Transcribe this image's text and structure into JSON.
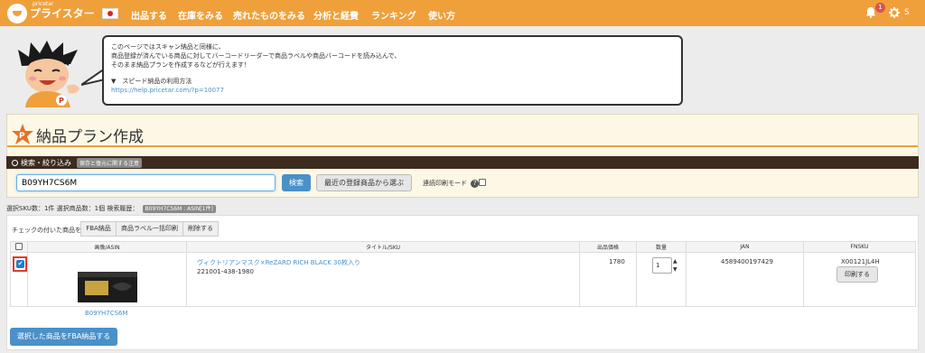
{
  "nav": {
    "logo_small": "pricetar",
    "logo_text": "プライスター",
    "items": [
      "出品する",
      "在庫をみる",
      "売れたものをみる",
      "分析と経費",
      "ランキング",
      "使い方"
    ],
    "notification_count": "1",
    "user_initial": "S"
  },
  "bubble": {
    "line1": "このページではスキャン納品と同様に、",
    "line2": "商品登録が済んでいる商品に対してバーコードリーダーで商品ラベルや商品バーコードを読み込んで、",
    "line3": "そのまま納品プランを作成するなどが行えます！",
    "speed_label": "▼　スピード納品の利用方法",
    "speed_url": "https://help.pricetar.com/?p=10077"
  },
  "page_title": "納品プラン作成",
  "search": {
    "header_label": "検索・絞り込み",
    "note_badge": "保存と復元に関する注意",
    "input_value": "B09YH7CS6M",
    "search_button": "検索",
    "recent_button": "最近の登録商品から選ぶ",
    "continuous_label": "連続印刷モード"
  },
  "stats": {
    "text": "選択SKU数：1件  選択商品数：1個  検索履歴：",
    "history_badge": "B09YH7CS6M : ASIN[1件]"
  },
  "bulk": {
    "label": "チェックの付いた商品を",
    "buttons": [
      "FBA納品",
      "商品ラベル一括印刷",
      "削除する"
    ]
  },
  "table": {
    "headers": [
      "",
      "画像/ASIN",
      "タイトル/SKU",
      "出品価格",
      "数量",
      "JAN",
      "FNSKU"
    ],
    "rows": [
      {
        "checked": true,
        "asin": "B09YH7CS6M",
        "title": "ヴィクトリアンマスク×ReZARD RICH BLACK 30枚入り",
        "sku": "221001-438-1980",
        "price": "1780",
        "qty": "1",
        "jan": "4589400197429",
        "fnsku": "X00121JL4H",
        "print_button": "印刷する"
      }
    ]
  },
  "fba_button": "選択した商品をFBA納品する",
  "colors": {
    "accent": "#f0a03a",
    "primary": "#4a90c9",
    "dark_header": "#3d2b1f",
    "highlight": "#e03b2a"
  }
}
